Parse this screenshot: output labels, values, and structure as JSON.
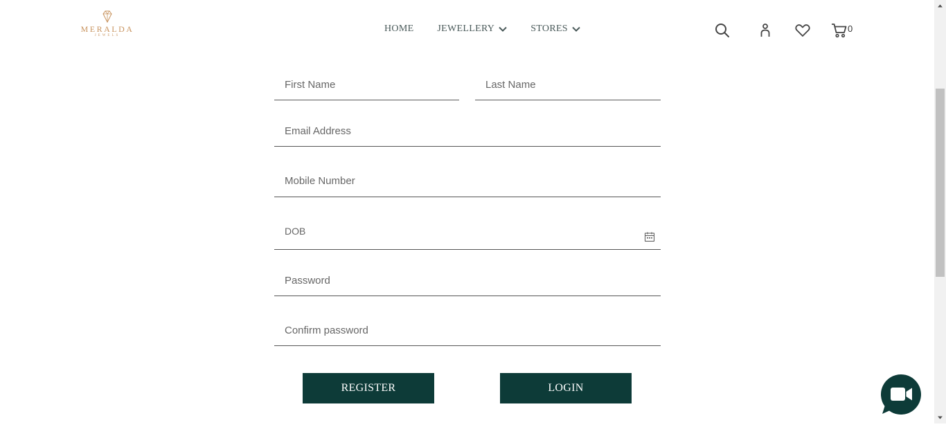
{
  "header": {
    "logo": {
      "brand": "MERALDA",
      "sub": "JEWELS"
    },
    "nav": [
      {
        "label": "HOME",
        "has_dropdown": false
      },
      {
        "label": "JEWELLERY",
        "has_dropdown": true
      },
      {
        "label": "STORES",
        "has_dropdown": true
      }
    ],
    "icons": [
      "search-icon",
      "user-icon",
      "heart-icon",
      "cart-icon"
    ],
    "cart_count": "0"
  },
  "form": {
    "first_name": {
      "placeholder": "First Name",
      "value": ""
    },
    "last_name": {
      "placeholder": "Last Name",
      "value": ""
    },
    "email": {
      "placeholder": "Email Address",
      "value": ""
    },
    "mobile": {
      "placeholder": "Mobile Number",
      "value": ""
    },
    "dob": {
      "placeholder": "DOB",
      "value": ""
    },
    "password": {
      "placeholder": "Password",
      "value": ""
    },
    "confirm_password": {
      "placeholder": "Confirm password",
      "value": ""
    },
    "register_label": "REGISTER",
    "login_label": "LOGIN"
  },
  "colors": {
    "brand_gold": "#c8935e",
    "button_bg": "#0d3b38",
    "fab_bg": "#0d3b38"
  }
}
